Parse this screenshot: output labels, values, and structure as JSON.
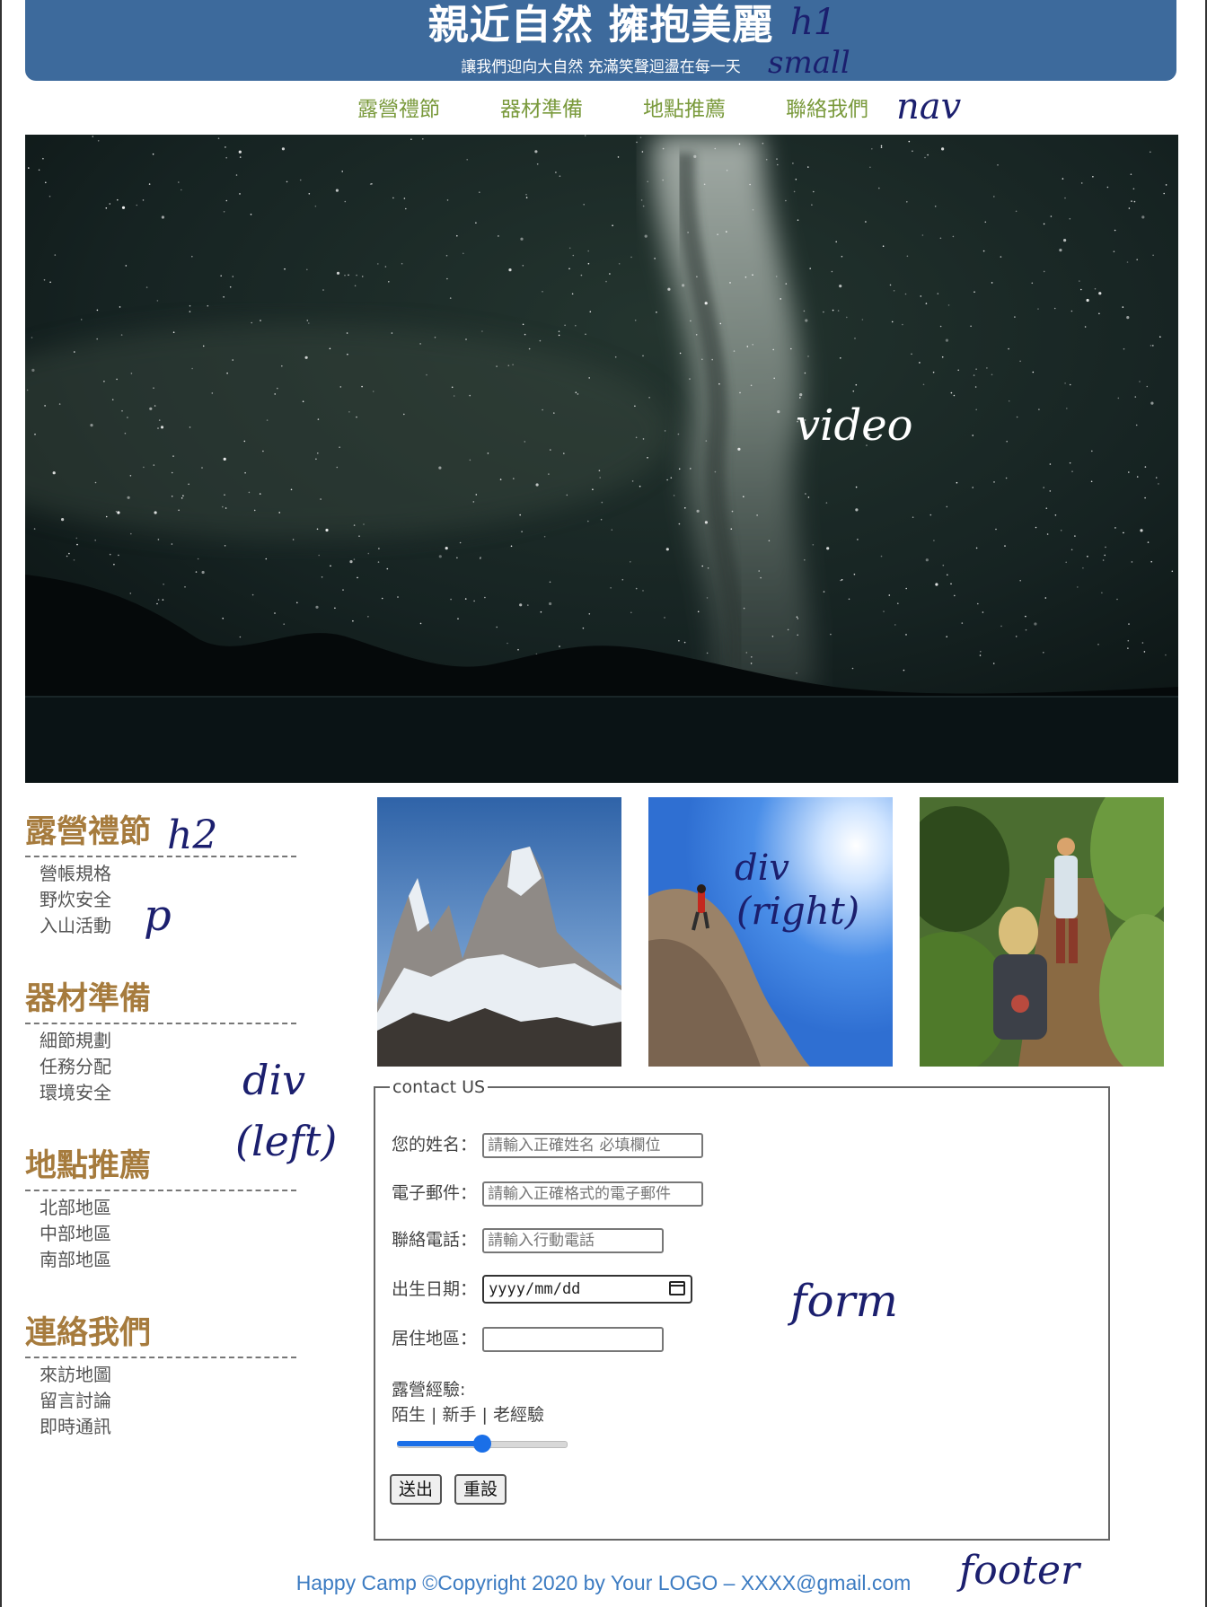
{
  "header": {
    "title": "親近自然 擁抱美麗",
    "subtitle": "讓我們迎向大自然 充滿笑聲迴盪在每一天",
    "bg_color": "#3d6a9c"
  },
  "nav": {
    "items": [
      "露營禮節",
      "器材準備",
      "地點推薦",
      "聯絡我們"
    ],
    "color": "#7a9a3c"
  },
  "left": {
    "sections": [
      {
        "title": "露營禮節",
        "items": [
          "營帳規格",
          "野炊安全",
          "入山活動"
        ]
      },
      {
        "title": "器材準備",
        "items": [
          "細節規劃",
          "任務分配",
          "環境安全"
        ]
      },
      {
        "title": "地點推薦",
        "items": [
          "北部地區",
          "中部地區",
          "南部地區"
        ]
      },
      {
        "title": "連絡我們",
        "items": [
          "來訪地圖",
          "留言討論",
          "即時通訊"
        ]
      }
    ],
    "title_color": "#a67b3d"
  },
  "form": {
    "legend": "contact US",
    "name_label": "您的姓名：",
    "name_placeholder": "請輸入正確姓名 必填欄位",
    "email_label": "電子郵件：",
    "email_placeholder": "請輸入正確格式的電子郵件",
    "phone_label": "聯絡電話：",
    "phone_placeholder": "請輸入行動電話",
    "birth_label": "出生日期：",
    "birth_value": "yyyy/mm/dd",
    "area_label": "居住地區：",
    "area_value": "",
    "experience_label": "露營經驗:",
    "experience_levels": "陌生 | 新手 | 老經驗",
    "experience_value": 0.5,
    "submit_label": "送出",
    "reset_label": "重設"
  },
  "footer": {
    "text": "Happy Camp ©Copyright 2020 by Your LOGO – XXXX@gmail.com",
    "color": "#3d7cc2"
  },
  "annotations": {
    "h1": "h1",
    "small": "small",
    "nav": "nav",
    "video": "video",
    "h2": "h2",
    "p": "p",
    "div_left_1": "div",
    "div_left_2": "(left)",
    "div_right_1": "div",
    "div_right_2": "(right)",
    "form": "form",
    "footer": "footer"
  }
}
